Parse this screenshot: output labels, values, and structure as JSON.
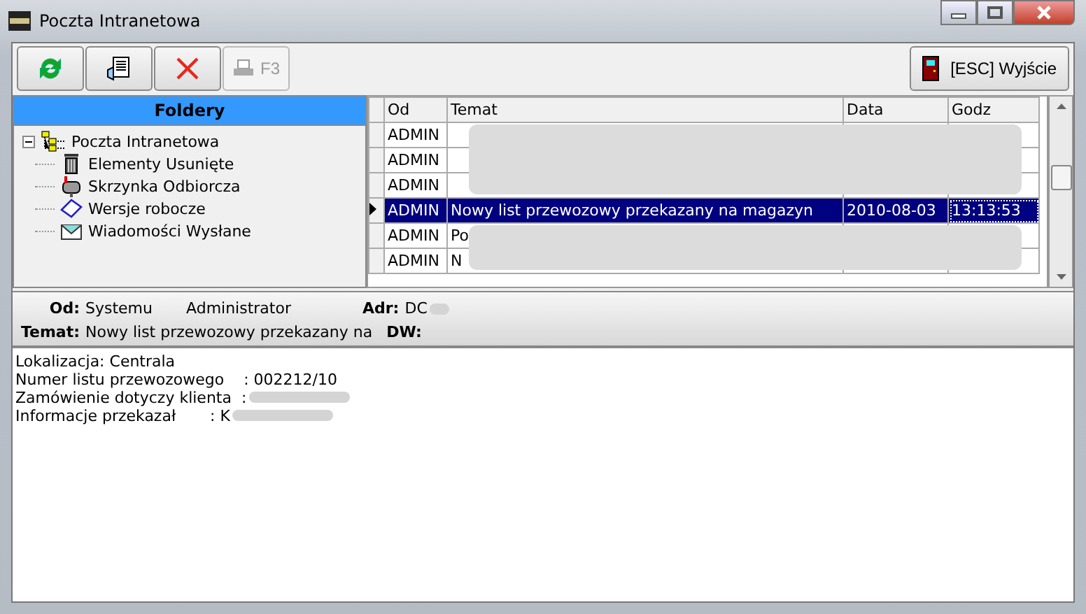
{
  "window": {
    "title": "Poczta Intranetowa"
  },
  "toolbar": {
    "buttons": [
      {
        "kind": "refresh",
        "disabled": false
      },
      {
        "kind": "document",
        "disabled": false
      },
      {
        "kind": "delete",
        "disabled": false
      },
      {
        "kind": "print",
        "label": "F3",
        "disabled": true
      }
    ],
    "exit_button": "[ESC] Wyjście"
  },
  "folders": {
    "title": "Foldery",
    "tree": {
      "label": "Poczta Intranetowa",
      "expanded": true,
      "children": [
        {
          "label": "Elementy Usunięte",
          "kind": "trash"
        },
        {
          "label": "Skrzynka Odbiorcza",
          "kind": "inbox"
        },
        {
          "label": "Wersje robocze",
          "kind": "drafts"
        },
        {
          "label": "Wiadomości Wysłane",
          "kind": "sent"
        }
      ]
    }
  },
  "table": {
    "columns": [
      "Od",
      "Temat",
      "Data",
      "Godz"
    ],
    "rows": [
      {
        "from": "ADMIN",
        "redacted": true,
        "selected": false
      },
      {
        "from": "ADMIN",
        "redacted": true,
        "selected": false
      },
      {
        "from": "ADMIN",
        "redacted": true,
        "selected": false
      },
      {
        "from": "ADMIN",
        "subject": "Nowy list przewozowy przekazany na magazyn",
        "date": "2010-08-03",
        "time": "13:13:53",
        "redacted": false,
        "selected": true
      },
      {
        "from": "ADMIN",
        "subject": "Po",
        "redacted": true,
        "selected": false
      },
      {
        "from": "ADMIN",
        "subject": "N",
        "redacted": true,
        "selected": false
      }
    ]
  },
  "header": {
    "from_label": "Od:",
    "from_first": "Systemu",
    "from_last": "Administrator",
    "adr_label": "Adr:",
    "adr_value": "DC",
    "subject_label": "Temat:",
    "subject_value": "Nowy list przewozowy przekazany na",
    "cc_label": "DW:"
  },
  "body": [
    {
      "text": "Lokalizacja: Centrala",
      "redacted": false
    },
    {
      "text": "Numer listu przewozowego    : 002212/10",
      "redacted": false
    },
    {
      "text": "Zamówienie dotyczy klienta  :",
      "redacted": true
    },
    {
      "text": "Informacje przekazał       : K",
      "redacted": true
    }
  ]
}
